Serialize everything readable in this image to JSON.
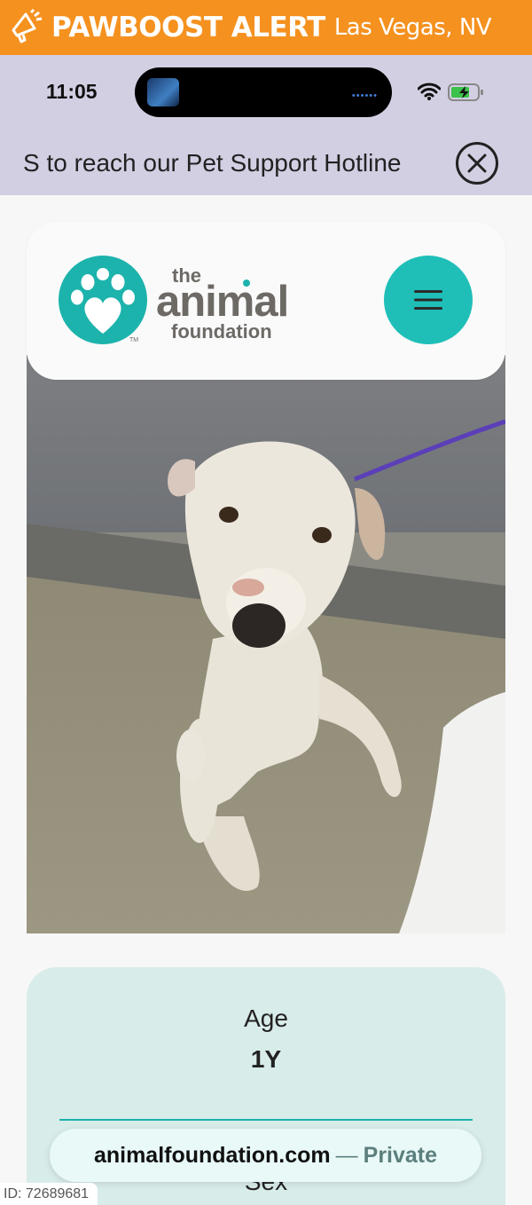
{
  "banner": {
    "title": "PAWBOOST ALERT",
    "location": "Las Vegas, NV",
    "color": "#f5911f",
    "icon": "megaphone-icon"
  },
  "status_bar": {
    "time": "11:05",
    "icons": [
      "wifi-icon",
      "battery-charging-icon"
    ]
  },
  "hotline": {
    "text": "S to reach our Pet Support Hotline",
    "close_icon": "close-circle-icon"
  },
  "site": {
    "logo": {
      "the": "the",
      "animal": "animal",
      "foundation": "foundation",
      "tm": "TM",
      "brand_color": "#1cb3ac"
    },
    "menu_icon": "hamburger-icon"
  },
  "pet": {
    "photo": "white dog sitting on kennel floor with purple leash",
    "age_label": "Age",
    "age_value": "1Y",
    "sex_label": "Sex"
  },
  "browser": {
    "domain": "animalfoundation.com",
    "separator": "—",
    "private_label": "Private"
  },
  "id_tag": "ID: 72689681"
}
